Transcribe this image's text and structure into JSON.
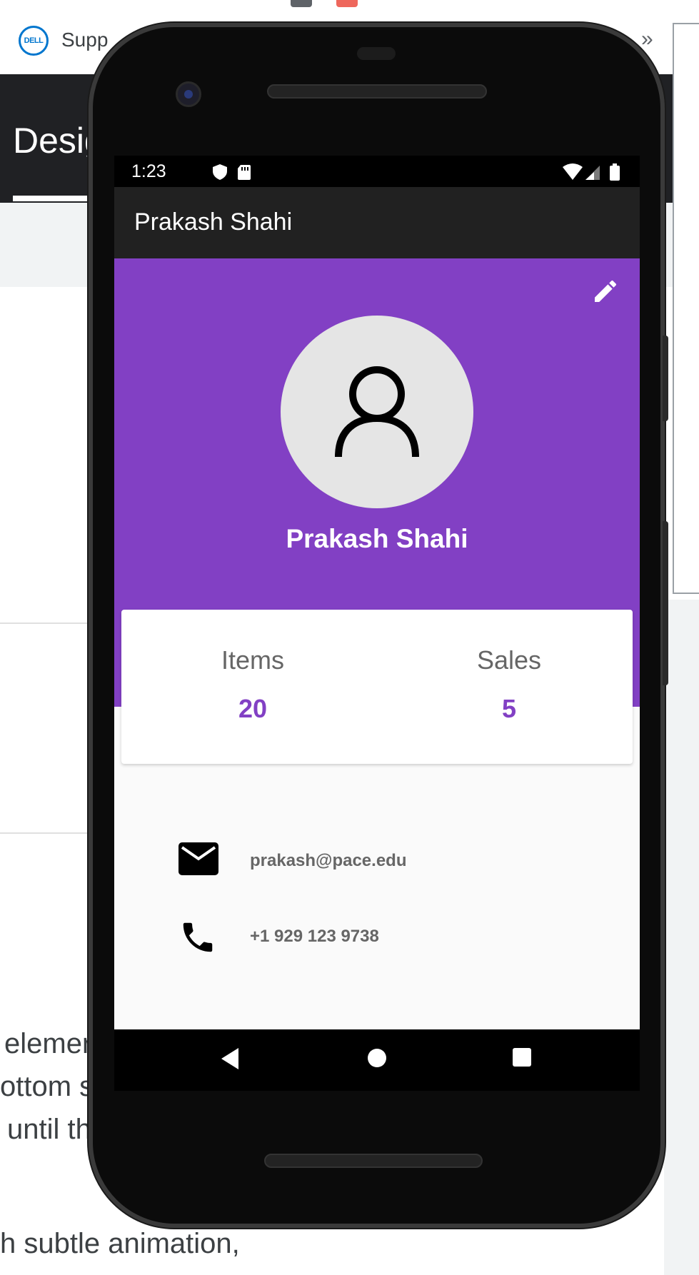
{
  "background": {
    "bookmark_text": "Supp",
    "bookmark_logo": "DELL",
    "overflow_chevron": "»",
    "header_title": "Desig",
    "paragraph_lines": [
      "elemer",
      "ottom s",
      "until th",
      "h subtle animation,"
    ]
  },
  "status_bar": {
    "time": "1:23",
    "icons": [
      "shield-icon",
      "sd-card-icon",
      "wifi-icon",
      "signal-icon",
      "battery-icon"
    ]
  },
  "app_bar": {
    "title": "Prakash Shahi"
  },
  "profile": {
    "name": "Prakash Shahi",
    "edit_icon": "pencil-icon",
    "avatar_icon": "person-icon"
  },
  "stats": [
    {
      "label": "Items",
      "value": "20"
    },
    {
      "label": "Sales",
      "value": "5"
    }
  ],
  "contacts": {
    "email": "prakash@pace.edu",
    "phone": "+1 929 123 9738"
  },
  "nav": {
    "buttons": [
      "back-icon",
      "home-icon",
      "recents-icon"
    ]
  },
  "colors": {
    "accent": "#8240c4",
    "app_bar": "#212121",
    "avatar_bg": "#e5e5e5",
    "muted_text": "#666666"
  }
}
